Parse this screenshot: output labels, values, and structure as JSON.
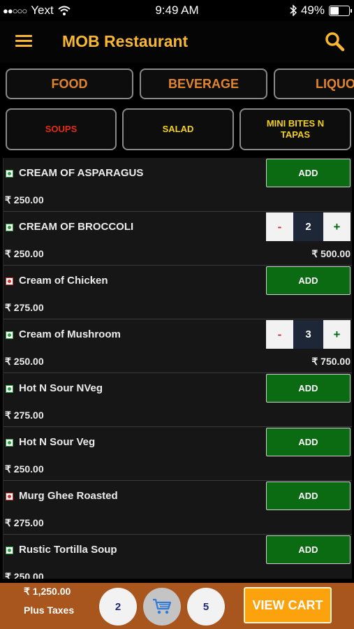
{
  "status_bar": {
    "signal_dots": "●●○○○",
    "carrier": "Yext",
    "time": "9:49 AM",
    "battery": "49%",
    "battery_level": 0.49
  },
  "header": {
    "title": "MOB Restaurant",
    "menu_icon": "hamburger-icon",
    "search_icon": "search-icon"
  },
  "categories": [
    {
      "label": "FOOD"
    },
    {
      "label": "BEVERAGE"
    },
    {
      "label": "LIQUO"
    }
  ],
  "subcategories": [
    {
      "label": "SOUPS",
      "active": true
    },
    {
      "label": "SALAD",
      "active": false
    },
    {
      "label": "MINI BITES N TAPAS",
      "active": false
    }
  ],
  "add_label": "ADD",
  "stepper": {
    "minus": "-",
    "plus": "+"
  },
  "items": [
    {
      "name": "CREAM OF ASPARAGUS",
      "price": "₹ 250.00",
      "veg": true
    },
    {
      "name": "CREAM OF BROCCOLI",
      "price": "₹ 250.00",
      "veg": true,
      "qty": "2",
      "total": "₹ 500.00"
    },
    {
      "name": "Cream of Chicken",
      "price": "₹ 275.00",
      "veg": false
    },
    {
      "name": "Cream of Mushroom",
      "price": "₹ 250.00",
      "veg": true,
      "qty": "3",
      "total": "₹ 750.00"
    },
    {
      "name": "Hot N Sour NVeg",
      "price": "₹ 275.00",
      "veg": true
    },
    {
      "name": "Hot N Sour Veg",
      "price": "₹ 250.00",
      "veg": true
    },
    {
      "name": "Murg Ghee Roasted",
      "price": "₹ 275.00",
      "veg": false
    },
    {
      "name": "Rustic Tortilla Soup",
      "price": "₹ 250.00",
      "veg": true
    }
  ],
  "footer": {
    "total": "₹ 1,250.00",
    "taxes": "Plus Taxes",
    "items_count": "2",
    "quantity_count": "5",
    "cart_icon": "cart-icon",
    "view_cart": "VIEW CART"
  },
  "colors": {
    "accent": "#f7b733",
    "add_green": "#0a6b12",
    "footer_brown": "#a8561d",
    "view_cart_orange": "#fca20d",
    "active_sub": "#e52a1a",
    "inactive_sub": "#f3d21b"
  }
}
